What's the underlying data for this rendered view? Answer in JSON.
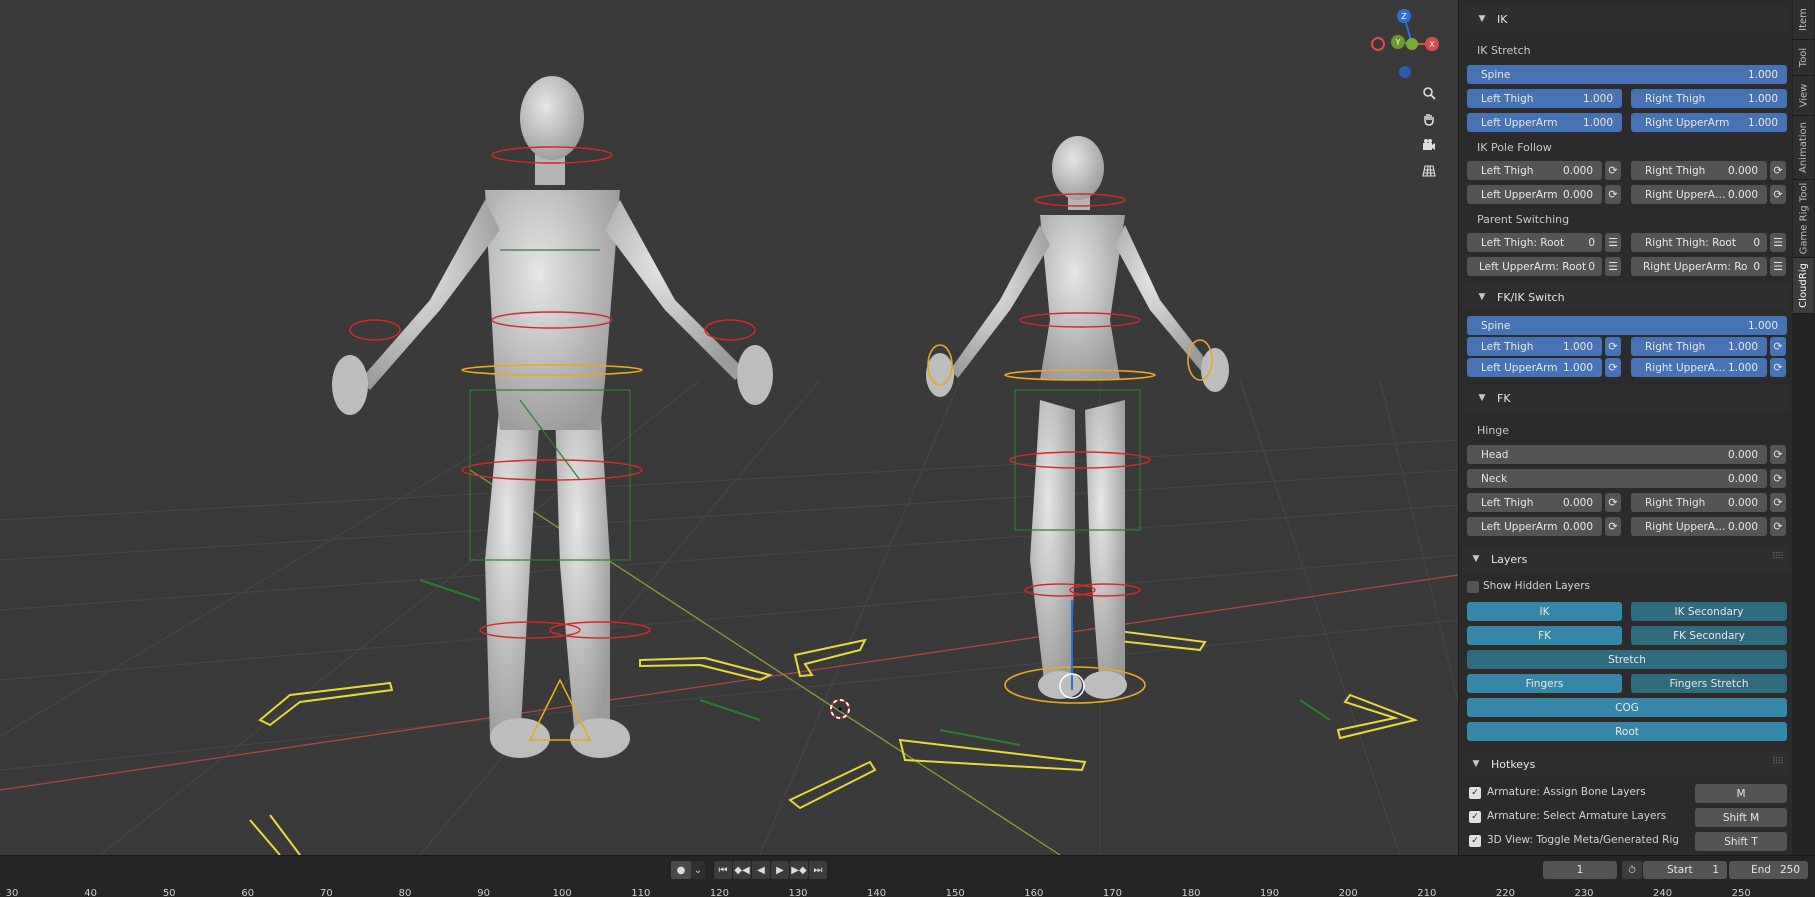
{
  "colors": {
    "accent_blue": "#4772b3",
    "layer_teal": "#2f6a7d",
    "layer_teal_active": "#3686a8",
    "bone_red": "#d62828",
    "bone_green": "#2e7d2e",
    "bone_yellow": "#e8d93a"
  },
  "gizmo": {
    "z": "Z",
    "y": "Y",
    "x": "X"
  },
  "view_tools": [
    "zoom-icon",
    "hand-icon",
    "camera-icon",
    "grid-icon"
  ],
  "tabs": [
    "Item",
    "Tool",
    "View",
    "Animation",
    "Game Rig Tool",
    "CloudRig"
  ],
  "ik": {
    "title": "IK",
    "stretch_label": "IK Stretch",
    "stretch": {
      "spine": {
        "label": "Spine",
        "value": "1.000"
      },
      "left_thigh": {
        "label": "Left Thigh",
        "value": "1.000"
      },
      "right_thigh": {
        "label": "Right Thigh",
        "value": "1.000"
      },
      "left_upperarm": {
        "label": "Left UpperArm",
        "value": "1.000"
      },
      "right_upperarm": {
        "label": "Right UpperArm",
        "value": "1.000"
      }
    },
    "pole_label": "IK Pole Follow",
    "pole": {
      "left_thigh": {
        "label": "Left Thigh",
        "value": "0.000"
      },
      "right_thigh": {
        "label": "Right Thigh",
        "value": "0.000"
      },
      "left_upperarm": {
        "label": "Left UpperArm",
        "value": "0.000"
      },
      "right_upperarm": {
        "label": "Right UpperArm",
        "value": "0.000"
      }
    },
    "parent_label": "Parent Switching",
    "parent": {
      "left_thigh": {
        "label": "Left Thigh: Root",
        "value": "0"
      },
      "right_thigh": {
        "label": "Right Thigh: Root",
        "value": "0"
      },
      "left_upperarm": {
        "label": "Left UpperArm: Root",
        "value": "0"
      },
      "right_upperarm": {
        "label": "Right UpperArm: Ro",
        "value": "0"
      }
    }
  },
  "fkik": {
    "title": "FK/IK Switch",
    "spine": {
      "label": "Spine",
      "value": "1.000"
    },
    "left_thigh": {
      "label": "Left Thigh",
      "value": "1.000"
    },
    "right_thigh": {
      "label": "Right Thigh",
      "value": "1.000"
    },
    "left_upperarm": {
      "label": "Left UpperArm",
      "value": "1.000"
    },
    "right_upperarm": {
      "label": "Right UpperArm",
      "value": "1.000"
    }
  },
  "fk": {
    "title": "FK",
    "hinge_label": "Hinge",
    "head": {
      "label": "Head",
      "value": "0.000"
    },
    "neck": {
      "label": "Neck",
      "value": "0.000"
    },
    "left_thigh": {
      "label": "Left Thigh",
      "value": "0.000"
    },
    "right_thigh": {
      "label": "Right Thigh",
      "value": "0.000"
    },
    "left_upperarm": {
      "label": "Left UpperArm",
      "value": "0.000"
    },
    "right_upperarm": {
      "label": "Right UpperArm",
      "value": "0.000"
    }
  },
  "layers": {
    "title": "Layers",
    "show_hidden": "Show Hidden Layers",
    "ik": "IK",
    "ik_secondary": "IK Secondary",
    "fk": "FK",
    "fk_secondary": "FK Secondary",
    "stretch": "Stretch",
    "fingers": "Fingers",
    "fingers_stretch": "Fingers Stretch",
    "cog": "COG",
    "root": "Root"
  },
  "hotkeys": {
    "title": "Hotkeys",
    "items": [
      {
        "label": "Armature: Assign Bone Layers",
        "key": "M"
      },
      {
        "label": "Armature: Select Armature Layers",
        "key": "Shift M"
      },
      {
        "label": "3D View: Toggle Meta/Generated Rig",
        "key": "Shift T"
      }
    ]
  },
  "timeline": {
    "current_frame": "1",
    "start_label": "Start",
    "start": "1",
    "end_label": "End",
    "end": "250",
    "ruler": [
      "30",
      "40",
      "50",
      "60",
      "70",
      "80",
      "90",
      "100",
      "110",
      "120",
      "130",
      "140",
      "150",
      "160",
      "170",
      "180",
      "190",
      "200",
      "210",
      "220",
      "230",
      "240",
      "250"
    ]
  }
}
